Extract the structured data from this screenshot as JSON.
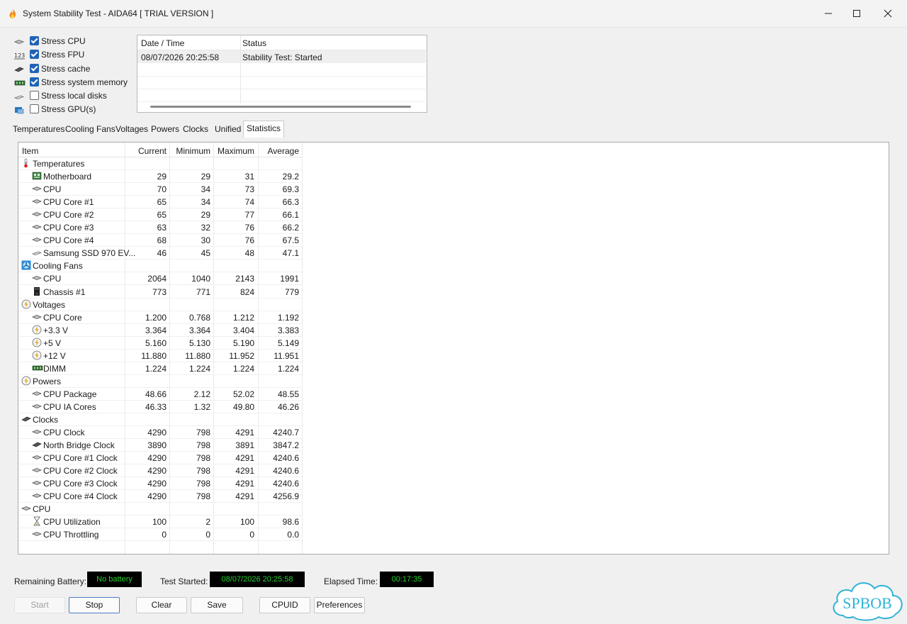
{
  "window": {
    "title": "System Stability Test - AIDA64  [ TRIAL VERSION ]"
  },
  "stress_options": [
    {
      "label": "Stress CPU",
      "checked": true,
      "icon": "cpu-chip-icon"
    },
    {
      "label": "Stress FPU",
      "checked": true,
      "icon": "fpu-123-icon"
    },
    {
      "label": "Stress cache",
      "checked": true,
      "icon": "cache-chip-icon"
    },
    {
      "label": "Stress system memory",
      "checked": true,
      "icon": "memory-module-icon"
    },
    {
      "label": "Stress local disks",
      "checked": false,
      "icon": "disk-drive-icon"
    },
    {
      "label": "Stress GPU(s)",
      "checked": false,
      "icon": "gpu-card-icon"
    }
  ],
  "log": {
    "headers": {
      "datetime": "Date / Time",
      "status": "Status"
    },
    "rows": [
      {
        "datetime": "08/07/2026 20:25:58",
        "status": "Stability Test: Started"
      }
    ]
  },
  "tabs": [
    "Temperatures",
    "Cooling Fans",
    "Voltages",
    "Powers",
    "Clocks",
    "Unified",
    "Statistics"
  ],
  "active_tab": "Statistics",
  "stats": {
    "headers": {
      "item": "Item",
      "current": "Current",
      "minimum": "Minimum",
      "maximum": "Maximum",
      "average": "Average"
    },
    "rows": [
      {
        "type": "group",
        "item": "Temperatures",
        "icon": "thermometer-icon"
      },
      {
        "type": "item",
        "item": "Motherboard",
        "current": "29",
        "minimum": "29",
        "maximum": "31",
        "average": "29.2",
        "icon": "motherboard-icon"
      },
      {
        "type": "item",
        "item": "CPU",
        "current": "70",
        "minimum": "34",
        "maximum": "73",
        "average": "69.3",
        "icon": "cpu-chip-icon"
      },
      {
        "type": "item",
        "item": "CPU Core #1",
        "current": "65",
        "minimum": "34",
        "maximum": "74",
        "average": "66.3",
        "icon": "cpu-chip-icon"
      },
      {
        "type": "item",
        "item": "CPU Core #2",
        "current": "65",
        "minimum": "29",
        "maximum": "77",
        "average": "66.1",
        "icon": "cpu-chip-icon"
      },
      {
        "type": "item",
        "item": "CPU Core #3",
        "current": "63",
        "minimum": "32",
        "maximum": "76",
        "average": "66.2",
        "icon": "cpu-chip-icon"
      },
      {
        "type": "item",
        "item": "CPU Core #4",
        "current": "68",
        "minimum": "30",
        "maximum": "76",
        "average": "67.5",
        "icon": "cpu-chip-icon"
      },
      {
        "type": "item",
        "item": "Samsung SSD 970 EV...",
        "current": "46",
        "minimum": "45",
        "maximum": "48",
        "average": "47.1",
        "icon": "disk-drive-icon"
      },
      {
        "type": "group",
        "item": "Cooling Fans",
        "icon": "fan-icon"
      },
      {
        "type": "item",
        "item": "CPU",
        "current": "2064",
        "minimum": "1040",
        "maximum": "2143",
        "average": "1991",
        "icon": "cpu-chip-icon"
      },
      {
        "type": "item",
        "item": "Chassis #1",
        "current": "773",
        "minimum": "771",
        "maximum": "824",
        "average": "779",
        "icon": "chassis-icon"
      },
      {
        "type": "group",
        "item": "Voltages",
        "icon": "voltage-icon"
      },
      {
        "type": "item",
        "item": "CPU Core",
        "current": "1.200",
        "minimum": "0.768",
        "maximum": "1.212",
        "average": "1.192",
        "icon": "cpu-chip-icon"
      },
      {
        "type": "item",
        "item": "+3.3 V",
        "current": "3.364",
        "minimum": "3.364",
        "maximum": "3.404",
        "average": "3.383",
        "icon": "voltage-icon"
      },
      {
        "type": "item",
        "item": "+5 V",
        "current": "5.160",
        "minimum": "5.130",
        "maximum": "5.190",
        "average": "5.149",
        "icon": "voltage-icon"
      },
      {
        "type": "item",
        "item": "+12 V",
        "current": "11.880",
        "minimum": "11.880",
        "maximum": "11.952",
        "average": "11.951",
        "icon": "voltage-icon"
      },
      {
        "type": "item",
        "item": "DIMM",
        "current": "1.224",
        "minimum": "1.224",
        "maximum": "1.224",
        "average": "1.224",
        "icon": "memory-module-icon"
      },
      {
        "type": "group",
        "item": "Powers",
        "icon": "voltage-icon"
      },
      {
        "type": "item",
        "item": "CPU Package",
        "current": "48.66",
        "minimum": "2.12",
        "maximum": "52.02",
        "average": "48.55",
        "icon": "cpu-chip-icon"
      },
      {
        "type": "item",
        "item": "CPU IA Cores",
        "current": "46.33",
        "minimum": "1.32",
        "maximum": "49.80",
        "average": "46.26",
        "icon": "cpu-chip-icon"
      },
      {
        "type": "group",
        "item": "Clocks",
        "icon": "cache-chip-icon"
      },
      {
        "type": "item",
        "item": "CPU Clock",
        "current": "4290",
        "minimum": "798",
        "maximum": "4291",
        "average": "4240.7",
        "icon": "cpu-chip-icon"
      },
      {
        "type": "item",
        "item": "North Bridge Clock",
        "current": "3890",
        "minimum": "798",
        "maximum": "3891",
        "average": "3847.2",
        "icon": "cache-chip-icon"
      },
      {
        "type": "item",
        "item": "CPU Core #1 Clock",
        "current": "4290",
        "minimum": "798",
        "maximum": "4291",
        "average": "4240.6",
        "icon": "cpu-chip-icon"
      },
      {
        "type": "item",
        "item": "CPU Core #2 Clock",
        "current": "4290",
        "minimum": "798",
        "maximum": "4291",
        "average": "4240.6",
        "icon": "cpu-chip-icon"
      },
      {
        "type": "item",
        "item": "CPU Core #3 Clock",
        "current": "4290",
        "minimum": "798",
        "maximum": "4291",
        "average": "4240.6",
        "icon": "cpu-chip-icon"
      },
      {
        "type": "item",
        "item": "CPU Core #4 Clock",
        "current": "4290",
        "minimum": "798",
        "maximum": "4291",
        "average": "4256.9",
        "icon": "cpu-chip-icon"
      },
      {
        "type": "group",
        "item": "CPU",
        "icon": "cpu-chip-icon"
      },
      {
        "type": "item",
        "item": "CPU Utilization",
        "current": "100",
        "minimum": "2",
        "maximum": "100",
        "average": "98.6",
        "icon": "hourglass-icon"
      },
      {
        "type": "item",
        "item": "CPU Throttling",
        "current": "0",
        "minimum": "0",
        "maximum": "0",
        "average": "0.0",
        "icon": "cpu-chip-icon"
      }
    ]
  },
  "status": {
    "battery_label": "Remaining Battery:",
    "battery_value": "No battery",
    "started_label": "Test Started:",
    "started_value": "08/07/2026 20:25:58",
    "elapsed_label": "Elapsed Time:",
    "elapsed_value": "00:17:35"
  },
  "buttons": {
    "start": "Start",
    "stop": "Stop",
    "clear": "Clear",
    "save": "Save",
    "cpuid": "CPUID",
    "preferences": "Preferences"
  },
  "watermark": {
    "text": "SPBOB"
  },
  "colors": {
    "checkbox": "#1f63b6",
    "status_text": "#23d12d",
    "status_bg": "#000000",
    "watermark": "#2fb3d6"
  }
}
